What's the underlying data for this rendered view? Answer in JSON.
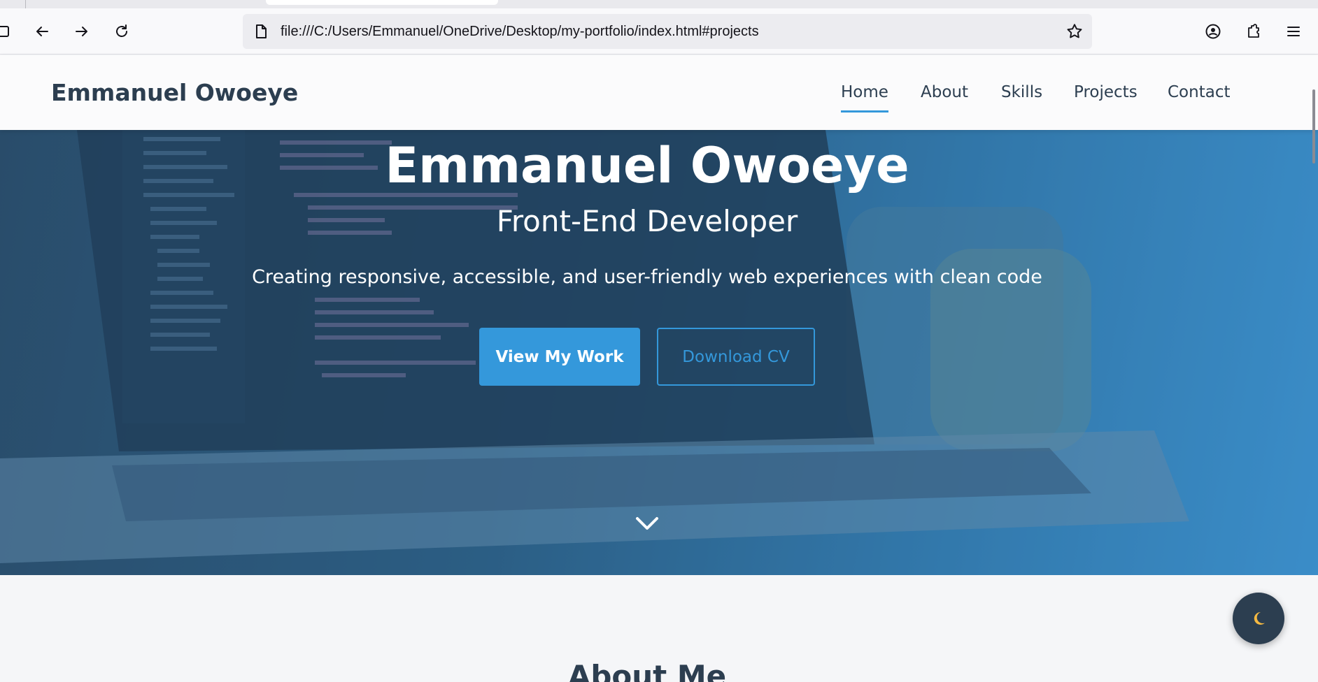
{
  "browser": {
    "url": "file:///C:/Users/Emmanuel/OneDrive/Desktop/my-portfolio/index.html#projects",
    "icons": [
      "sidebar-icon",
      "back-icon",
      "forward-icon",
      "reload-icon",
      "page-icon",
      "bookmark-star-icon",
      "account-icon",
      "extensions-icon",
      "menu-icon"
    ]
  },
  "navbar": {
    "brand": "Emmanuel Owoeye",
    "links": [
      {
        "label": "Home",
        "active": true
      },
      {
        "label": "About",
        "active": false
      },
      {
        "label": "Skills",
        "active": false
      },
      {
        "label": "Projects",
        "active": false
      },
      {
        "label": "Contact",
        "active": false
      }
    ]
  },
  "hero": {
    "title": "Emmanuel Owoeye",
    "subtitle": "Front-End Developer",
    "description": "Creating responsive, accessible, and user-friendly web experiences with clean code",
    "primary_button": "View My Work",
    "secondary_button": "Download CV"
  },
  "about": {
    "title": "About Me"
  },
  "theme_toggle": {
    "icon": "moon-icon"
  },
  "colors": {
    "accent": "#3498db",
    "text_dark": "#2c3e50",
    "moon": "#f5b942"
  }
}
